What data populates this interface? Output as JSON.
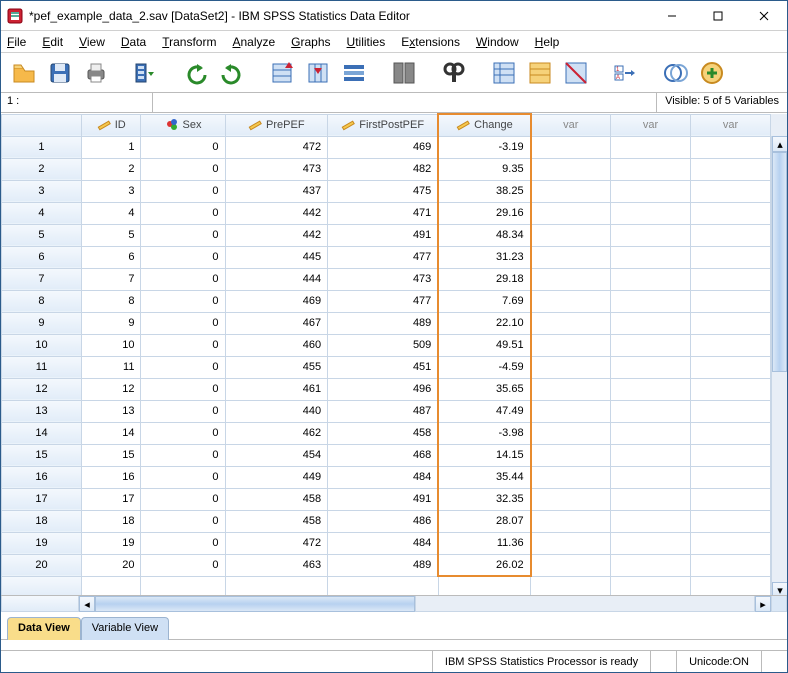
{
  "window": {
    "title": "*pef_example_data_2.sav [DataSet2] - IBM SPSS Statistics Data Editor"
  },
  "menu": {
    "file": "File",
    "edit": "Edit",
    "view": "View",
    "data": "Data",
    "transform": "Transform",
    "analyze": "Analyze",
    "graphs": "Graphs",
    "utilities": "Utilities",
    "extensions": "Extensions",
    "window": "Window",
    "help": "Help"
  },
  "editbar": {
    "cellref": "1 :",
    "visible": "Visible: 5 of 5 Variables"
  },
  "columns": {
    "id": "ID",
    "sex": "Sex",
    "prepef": "PrePEF",
    "firstpost": "FirstPostPEF",
    "change": "Change",
    "var": "var"
  },
  "rows": [
    {
      "n": "1",
      "id": "1",
      "sex": "0",
      "pre": "472",
      "first": "469",
      "change": "-3.19"
    },
    {
      "n": "2",
      "id": "2",
      "sex": "0",
      "pre": "473",
      "first": "482",
      "change": "9.35"
    },
    {
      "n": "3",
      "id": "3",
      "sex": "0",
      "pre": "437",
      "first": "475",
      "change": "38.25"
    },
    {
      "n": "4",
      "id": "4",
      "sex": "0",
      "pre": "442",
      "first": "471",
      "change": "29.16"
    },
    {
      "n": "5",
      "id": "5",
      "sex": "0",
      "pre": "442",
      "first": "491",
      "change": "48.34"
    },
    {
      "n": "6",
      "id": "6",
      "sex": "0",
      "pre": "445",
      "first": "477",
      "change": "31.23"
    },
    {
      "n": "7",
      "id": "7",
      "sex": "0",
      "pre": "444",
      "first": "473",
      "change": "29.18"
    },
    {
      "n": "8",
      "id": "8",
      "sex": "0",
      "pre": "469",
      "first": "477",
      "change": "7.69"
    },
    {
      "n": "9",
      "id": "9",
      "sex": "0",
      "pre": "467",
      "first": "489",
      "change": "22.10"
    },
    {
      "n": "10",
      "id": "10",
      "sex": "0",
      "pre": "460",
      "first": "509",
      "change": "49.51"
    },
    {
      "n": "11",
      "id": "11",
      "sex": "0",
      "pre": "455",
      "first": "451",
      "change": "-4.59"
    },
    {
      "n": "12",
      "id": "12",
      "sex": "0",
      "pre": "461",
      "first": "496",
      "change": "35.65"
    },
    {
      "n": "13",
      "id": "13",
      "sex": "0",
      "pre": "440",
      "first": "487",
      "change": "47.49"
    },
    {
      "n": "14",
      "id": "14",
      "sex": "0",
      "pre": "462",
      "first": "458",
      "change": "-3.98"
    },
    {
      "n": "15",
      "id": "15",
      "sex": "0",
      "pre": "454",
      "first": "468",
      "change": "14.15"
    },
    {
      "n": "16",
      "id": "16",
      "sex": "0",
      "pre": "449",
      "first": "484",
      "change": "35.44"
    },
    {
      "n": "17",
      "id": "17",
      "sex": "0",
      "pre": "458",
      "first": "491",
      "change": "32.35"
    },
    {
      "n": "18",
      "id": "18",
      "sex": "0",
      "pre": "458",
      "first": "486",
      "change": "28.07"
    },
    {
      "n": "19",
      "id": "19",
      "sex": "0",
      "pre": "472",
      "first": "484",
      "change": "11.36"
    },
    {
      "n": "20",
      "id": "20",
      "sex": "0",
      "pre": "463",
      "first": "489",
      "change": "26.02"
    }
  ],
  "tabs": {
    "data": "Data View",
    "variable": "Variable View"
  },
  "status": {
    "processor": "IBM SPSS Statistics Processor is ready",
    "unicode": "Unicode:ON"
  }
}
